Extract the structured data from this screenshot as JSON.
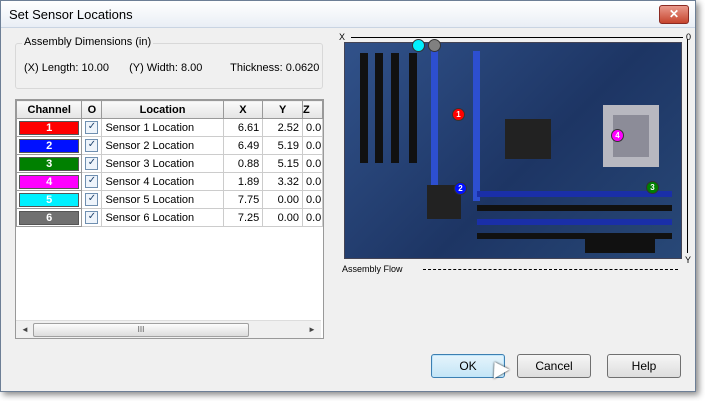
{
  "window": {
    "title": "Set Sensor Locations",
    "close_glyph": "✕"
  },
  "dimensions": {
    "legend": "Assembly Dimensions (in)",
    "length": "(X) Length: 10.00",
    "width": "(Y) Width:  8.00",
    "thickness": "Thickness: 0.0620"
  },
  "table": {
    "headers": [
      "Channel",
      "O",
      "Location",
      "X",
      "Y",
      "Z"
    ],
    "rows": [
      {
        "channel": "1",
        "color": "#ff0000",
        "checked": true,
        "location": "Sensor 1 Location",
        "x": "6.61",
        "y": "2.52",
        "z": "0.0"
      },
      {
        "channel": "2",
        "color": "#0010ff",
        "checked": true,
        "location": "Sensor 2 Location",
        "x": "6.49",
        "y": "5.19",
        "z": "0.0"
      },
      {
        "channel": "3",
        "color": "#008000",
        "checked": true,
        "location": "Sensor 3 Location",
        "x": "0.88",
        "y": "5.15",
        "z": "0.0"
      },
      {
        "channel": "4",
        "color": "#ff00ff",
        "checked": true,
        "location": "Sensor 4 Location",
        "x": "1.89",
        "y": "3.32",
        "z": "0.0"
      },
      {
        "channel": "5",
        "color": "#00f0ff",
        "checked": true,
        "location": "Sensor 5 Location",
        "x": "7.75",
        "y": "0.00",
        "z": "0.0"
      },
      {
        "channel": "6",
        "color": "#707070",
        "checked": true,
        "location": "Sensor 6 Location",
        "x": "7.25",
        "y": "0.00",
        "z": "0.0"
      }
    ],
    "scroll_left": "◄",
    "scroll_right": "►",
    "scroll_grip": "III"
  },
  "board": {
    "x_axis_start": "X",
    "x_axis_end": "0",
    "y_axis_end": "Y",
    "flow_label": "Assembly Flow",
    "markers": [
      {
        "label": "1",
        "color": "#ff0000"
      },
      {
        "label": "2",
        "color": "#0010ff"
      },
      {
        "label": "3",
        "color": "#008000"
      },
      {
        "label": "4",
        "color": "#ff00ff"
      },
      {
        "label": "",
        "color": "#00f0ff"
      },
      {
        "label": "",
        "color": "#808080"
      }
    ]
  },
  "buttons": {
    "ok": "OK",
    "cancel": "Cancel",
    "help": "Help"
  }
}
